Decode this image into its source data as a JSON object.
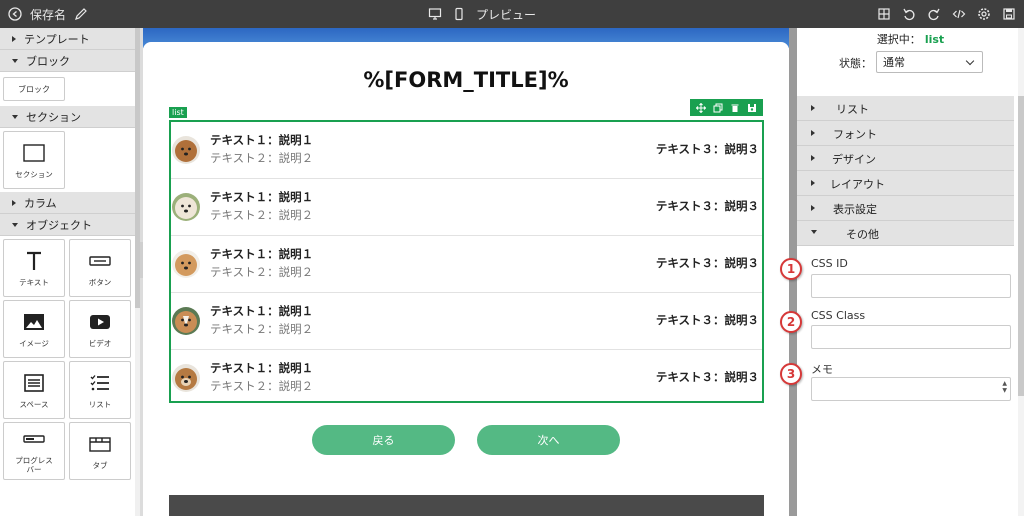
{
  "topbar": {
    "title": "保存名",
    "preview": "プレビュー",
    "icons": [
      "back-circle-icon",
      "pencil-icon",
      "desktop-icon",
      "mobile-icon",
      "grid-icon",
      "undo-icon",
      "redo-icon",
      "code-icon",
      "gear-icon",
      "save-icon"
    ]
  },
  "sidebar": {
    "template": "テンプレート",
    "block": "ブロック",
    "block_item": "ブロック",
    "section": "セクション",
    "section_item": "セクション",
    "column": "カラム",
    "object": "オブジェクト",
    "tiles": [
      {
        "label": "テキスト",
        "icon": "text-icon"
      },
      {
        "label": "ボタン",
        "icon": "button-icon"
      },
      {
        "label": "イメージ",
        "icon": "image-icon"
      },
      {
        "label": "ビデオ",
        "icon": "video-icon"
      },
      {
        "label": "スペース",
        "icon": "space-icon"
      },
      {
        "label": "リスト",
        "icon": "list-icon"
      },
      {
        "label": "プログレス\nバー",
        "icon": "progress-bar-icon"
      },
      {
        "label": "タブ",
        "icon": "tab-icon"
      }
    ]
  },
  "canvas": {
    "form_title": "%[FORM_TITLE]%",
    "list_tag": "list",
    "rows": [
      {
        "t1": "テキスト１：説明１",
        "t2": "テキスト２：説明２",
        "t3": "テキスト３：説明３",
        "avatar_color": "#b0703a"
      },
      {
        "t1": "テキスト１：説明１",
        "t2": "テキスト２：説明２",
        "t3": "テキスト３：説明３",
        "avatar_color": "#e8dcc8"
      },
      {
        "t1": "テキスト１：説明１",
        "t2": "テキスト２：説明２",
        "t3": "テキスト３：説明３",
        "avatar_color": "#d39a5e"
      },
      {
        "t1": "テキスト１：説明１",
        "t2": "テキスト２：説明２",
        "t3": "テキスト３：説明３",
        "avatar_color": "#c98d55"
      },
      {
        "t1": "テキスト１：説明１",
        "t2": "テキスト２：説明２",
        "t3": "テキスト３：説明３",
        "avatar_color": "#b57a42"
      }
    ],
    "back_button": "戻る",
    "next_button": "次へ"
  },
  "panel": {
    "selected_label": "選択中：",
    "selected_value": "list",
    "state_label": "状態：",
    "state_value": "通常",
    "accordion": [
      "リスト",
      "フォント",
      "デザイン",
      "レイアウト",
      "表示設定",
      "その他"
    ],
    "css_id_label": "CSS ID",
    "css_class_label": "CSS Class",
    "memo_label": "メモ",
    "callouts": [
      "1",
      "2",
      "3"
    ]
  },
  "colors": {
    "accent": "#19a050",
    "button": "#54b984",
    "topbar": "#3f3f3f",
    "callout": "#d63838"
  }
}
